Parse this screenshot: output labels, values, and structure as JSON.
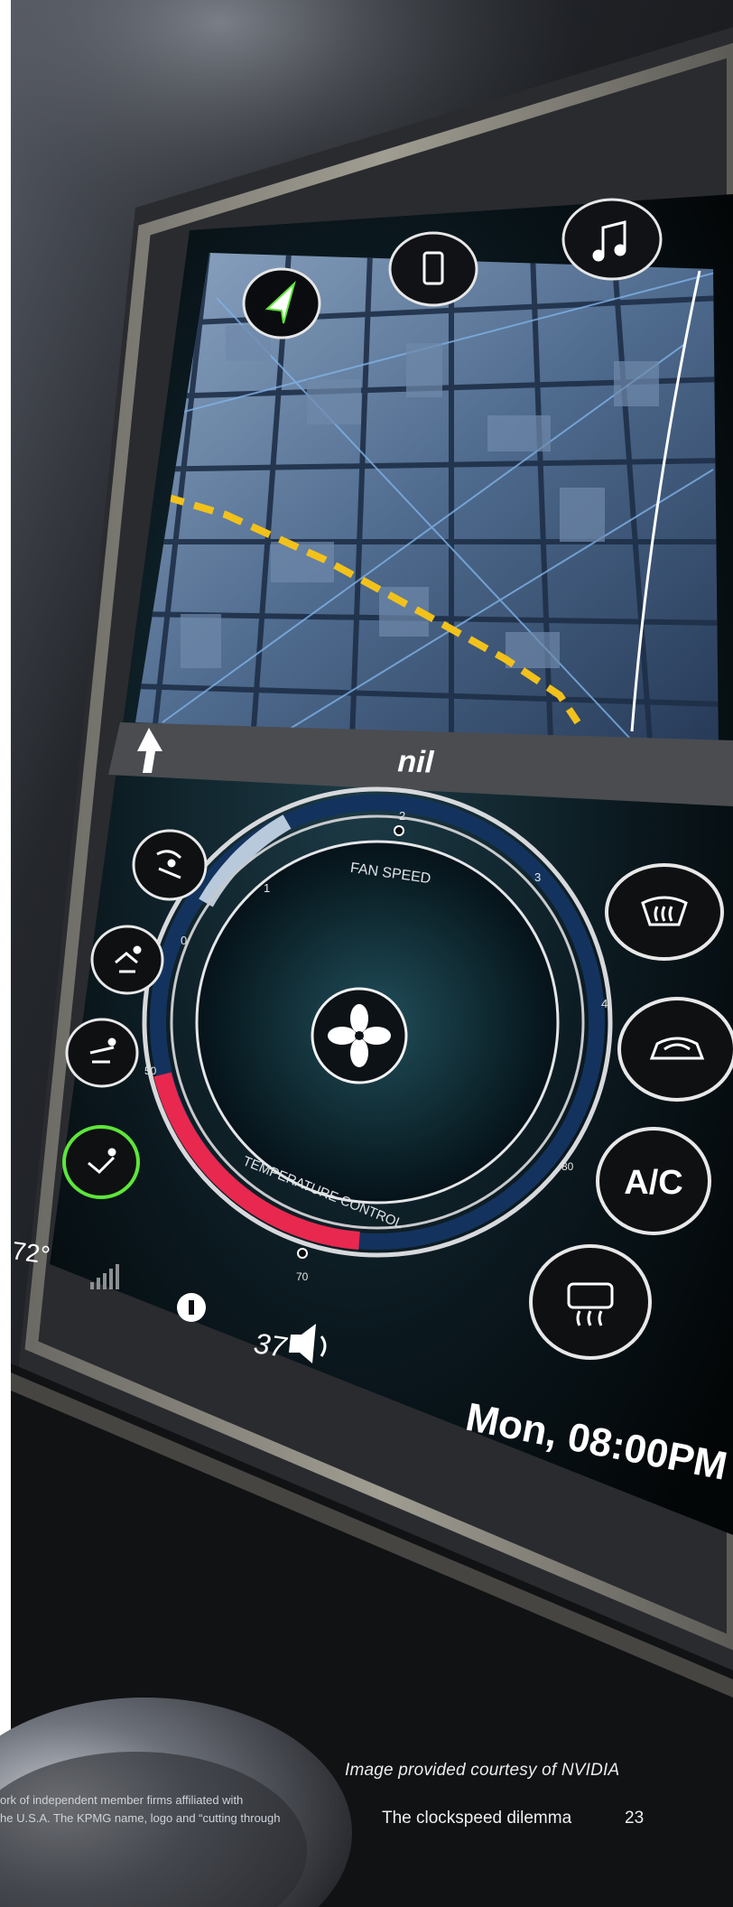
{
  "dashboard": {
    "nav_icons": [
      "navigation-arrow-icon",
      "phone-icon",
      "music-note-icon"
    ],
    "map": {
      "instruction": "nil",
      "direction_icon": "arrow-up-icon"
    },
    "climate": {
      "fan_speed_label": "FAN SPEED",
      "temperature_control_label": "TEMPERATURE CONTROL",
      "fan_ticks": [
        "0",
        "1",
        "2",
        "3",
        "4"
      ],
      "temp_ticks": [
        "50",
        "70",
        "80"
      ],
      "left_buttons": [
        "seat-heat-icon",
        "airflow-upper-icon",
        "airflow-mid-icon",
        "airflow-feet-icon"
      ],
      "right_buttons": [
        "front-defrost-icon",
        "recirculate-icon",
        "ac-button",
        "rear-defrost-icon"
      ],
      "ac_label": "A/C"
    },
    "status": {
      "temperature": "72°",
      "volume": "37",
      "datetime": "Mon, 08:00PM"
    },
    "colors": {
      "accent_green": "#5ee63a",
      "temp_red": "#e8284f",
      "map_route_yellow": "#f2c21b",
      "map_blue": "#3d6fae"
    }
  },
  "page": {
    "caption": "Image provided courtesy of NVIDIA",
    "legal_line1": "ork of independent member firms affiliated with",
    "legal_line2": "he U.S.A. The KPMG name, logo and “cutting through",
    "footer_title": "The clockspeed dilemma",
    "page_number": "23"
  }
}
